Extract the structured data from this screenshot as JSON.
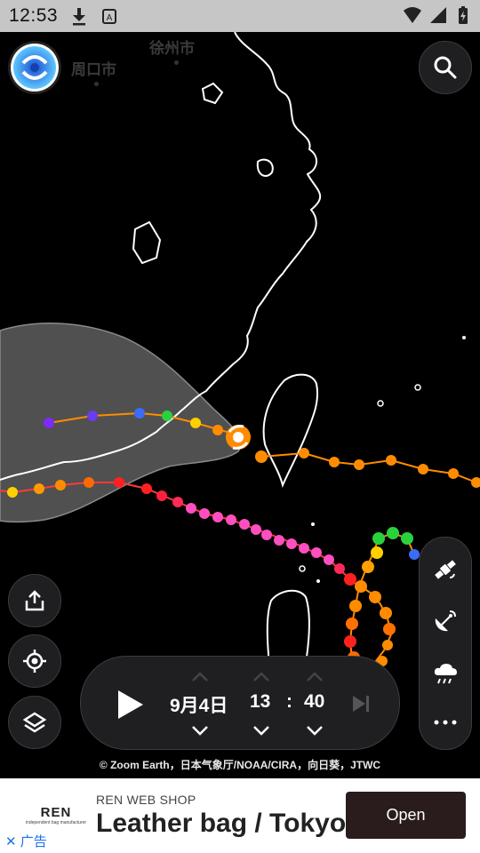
{
  "status_bar": {
    "time": "12:53"
  },
  "map": {
    "cities": [
      {
        "name": "徐州市"
      },
      {
        "name": "周口市"
      }
    ],
    "track_colors": [
      "#7b2cf5",
      "#3b6cf7",
      "#2bd13c",
      "#ffd000",
      "#ff8c00",
      "#ff2020",
      "#ff4fbf",
      "#ffffff"
    ]
  },
  "toolbar": {
    "search_icon": "search-icon",
    "share_icon": "share-icon",
    "locate_icon": "locate-icon",
    "layers_icon": "layers-icon",
    "satellite_icon": "satellite-icon",
    "radar_icon": "radar-icon",
    "rain_icon": "rain-icon",
    "more_icon": "more-icon"
  },
  "timebar": {
    "date": "9月4日",
    "hour": "13",
    "colon": ":",
    "minute": "40"
  },
  "credits": "© Zoom Earth，日本气象厅/NOAA/CIRA，向日葵，JTWC",
  "ad": {
    "brand_name": "REN",
    "brand_tagline": "independent bag manufacturer",
    "shop": "REN WEB SHOP",
    "headline": "Leather bag / Tokyo",
    "cta": "Open",
    "label": "广告"
  }
}
